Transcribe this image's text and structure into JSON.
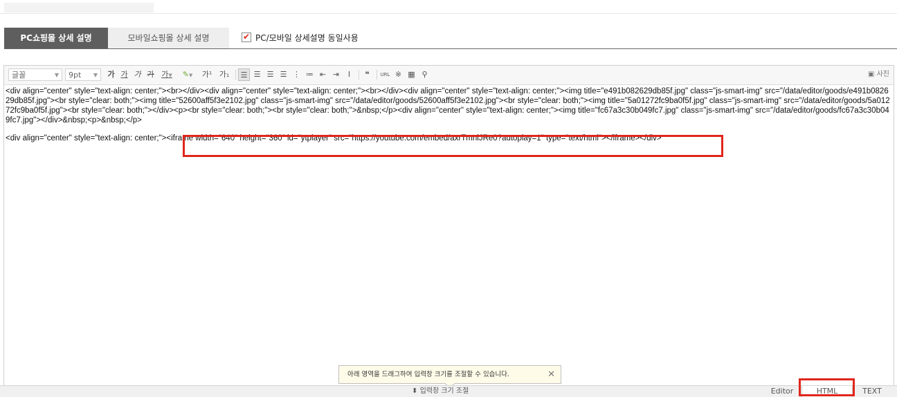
{
  "tabs": {
    "pc": "PC쇼핑몰 상세 설명",
    "mobile": "모바일쇼핑몰 상세 설명",
    "sync_label": "PC/모바일 상세설명 동일사용",
    "sync_checked": true
  },
  "toolbar": {
    "font": "글꼴",
    "size": "9pt",
    "bold": "가",
    "underline": "가",
    "italic": "가",
    "strike": "가",
    "font_color": "가",
    "bg_color": "가",
    "superscript": "가¹",
    "subscript": "가₁",
    "photo": "사진"
  },
  "code": {
    "block1": "<div align=\"center\" style=\"text-align: center;\"><br></div><div align=\"center\" style=\"text-align: center;\"><br></div><div align=\"center\" style=\"text-align: center;\"><img title=\"e491b082629db85f.jpg\" class=\"js-smart-img\" src=\"/data/editor/goods/e491b082629db85f.jpg\"><br style=\"clear: both;\"><img title=\"52600aff5f3e2102.jpg\" class=\"js-smart-img\" src=\"/data/editor/goods/52600aff5f3e2102.jpg\"><br style=\"clear: both;\"><img title=\"5a01272fc9ba0f5f.jpg\" class=\"js-smart-img\" src=\"/data/editor/goods/5a01272fc9ba0f5f.jpg\"><br style=\"clear: both;\"></div><p><br style=\"clear: both;\"><br style=\"clear: both;\">&nbsp;</p><div align=\"center\" style=\"text-align: center;\"><img title=\"fc67a3c30b049fc7.jpg\" class=\"js-smart-img\" src=\"/data/editor/goods/fc67a3c30b049fc7.jpg\"></div>&nbsp;<p>&nbsp;</p>",
    "block2": "<div align=\"center\" style=\"text-align: center;\"><iframe width=\"640\" height=\"360\" id=\"ytplayer\" src=\"https://youtube.com/embed/axrTmniJRe0?autoplay=1\" type=\"text/html\"></iframe></div>"
  },
  "tooltip": {
    "text": "아래 영역을 드래그하여 입력창 크기를 조절할 수 있습니다.",
    "close": "✕"
  },
  "bottom": {
    "resize": "입력창 크기 조절",
    "modes": [
      "Editor",
      "HTML",
      "TEXT"
    ],
    "active_mode": "HTML"
  },
  "colors": {
    "highlight": "#e0251b",
    "active_tab": "#5e5e5e"
  }
}
